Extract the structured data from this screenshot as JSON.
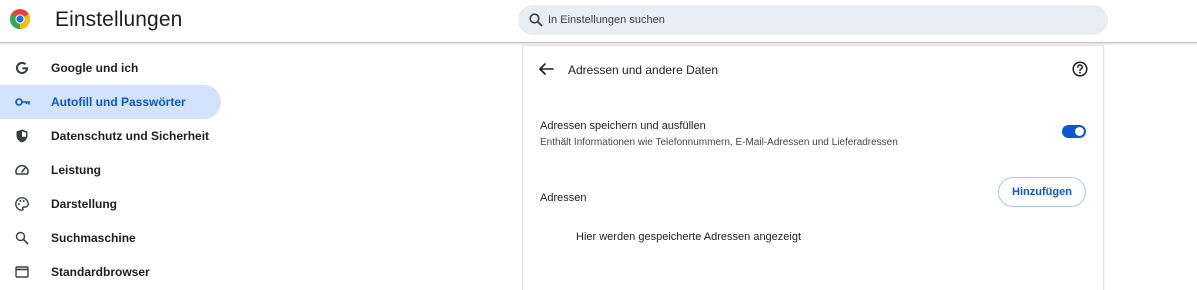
{
  "app": {
    "title": "Einstellungen",
    "logo_icon": "chrome-logo-icon"
  },
  "search": {
    "placeholder": "In Einstellungen suchen",
    "icon": "search-icon"
  },
  "sidebar": {
    "items": [
      {
        "label": "Google und ich",
        "icon": "google-g-icon",
        "active": false
      },
      {
        "label": "Autofill und Passwörter",
        "icon": "key-icon",
        "active": true
      },
      {
        "label": "Datenschutz und Sicherheit",
        "icon": "shield-icon",
        "active": false
      },
      {
        "label": "Leistung",
        "icon": "speedometer-icon",
        "active": false
      },
      {
        "label": "Darstellung",
        "icon": "palette-icon",
        "active": false
      },
      {
        "label": "Suchmaschine",
        "icon": "search-icon",
        "active": false
      },
      {
        "label": "Standardbrowser",
        "icon": "browser-window-icon",
        "active": false
      }
    ]
  },
  "main": {
    "title": "Adressen und andere Daten",
    "setting": {
      "title": "Adressen speichern und ausfüllen",
      "description": "Enthält Informationen wie Telefonnummern, E-Mail-Adressen und Lieferadressen",
      "enabled": true
    },
    "addresses": {
      "label": "Adressen",
      "add_button": "Hinzufügen",
      "empty_text": "Hier werden gespeicherte Adressen angezeigt"
    }
  },
  "colors": {
    "accent": "#0b57d0",
    "active_bg": "#d3e3fd",
    "search_bg": "#e9eef6"
  }
}
